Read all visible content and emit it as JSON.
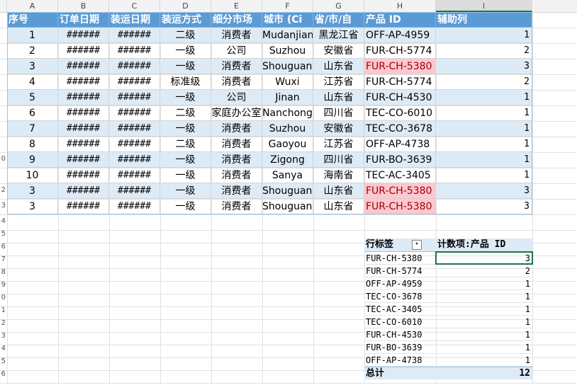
{
  "column_letters": [
    "A",
    "B",
    "C",
    "D",
    "E",
    "F",
    "G",
    "H",
    "I"
  ],
  "selected_column": "I",
  "row_numbers": [
    "",
    "",
    "",
    "",
    "",
    "",
    "",
    "",
    "",
    "0",
    "",
    "2",
    "3",
    "4",
    "5",
    "6",
    "7",
    "8",
    "9",
    "0",
    "1",
    "2",
    "3",
    "4",
    "5",
    "6"
  ],
  "table": {
    "headers": [
      "序号",
      "订单日期",
      "装运日期",
      "装运方式",
      "细分市场",
      "城市 (Ci",
      "省/市/自",
      "产品 ID",
      "辅助列"
    ],
    "rows": [
      {
        "no": "1",
        "order": "######",
        "ship": "######",
        "mode": "二级",
        "seg": "消费者",
        "city": "Mudanjiang",
        "prov": "黑龙江省",
        "pid": "OFF-AP-4959",
        "aux": "1",
        "hl": false
      },
      {
        "no": "2",
        "order": "######",
        "ship": "######",
        "mode": "一级",
        "seg": "公司",
        "city": "Suzhou",
        "prov": "安徽省",
        "pid": "FUR-CH-5774",
        "aux": "2",
        "hl": false
      },
      {
        "no": "3",
        "order": "######",
        "ship": "######",
        "mode": "一级",
        "seg": "消费者",
        "city": "Shouguang",
        "prov": "山东省",
        "pid": "FUR-CH-5380",
        "aux": "3",
        "hl": true
      },
      {
        "no": "4",
        "order": "######",
        "ship": "######",
        "mode": "标准级",
        "seg": "消费者",
        "city": "Wuxi",
        "prov": "江苏省",
        "pid": "FUR-CH-5774",
        "aux": "2",
        "hl": false
      },
      {
        "no": "5",
        "order": "######",
        "ship": "######",
        "mode": "一级",
        "seg": "公司",
        "city": "Jinan",
        "prov": "山东省",
        "pid": "FUR-CH-4530",
        "aux": "1",
        "hl": false
      },
      {
        "no": "6",
        "order": "######",
        "ship": "######",
        "mode": "二级",
        "seg": "家庭办公室",
        "city": "Nanchong",
        "prov": "四川省",
        "pid": "TEC-CO-6010",
        "aux": "1",
        "hl": false
      },
      {
        "no": "7",
        "order": "######",
        "ship": "######",
        "mode": "一级",
        "seg": "消费者",
        "city": "Suzhou",
        "prov": "安徽省",
        "pid": "TEC-CO-3678",
        "aux": "1",
        "hl": false
      },
      {
        "no": "8",
        "order": "######",
        "ship": "######",
        "mode": "二级",
        "seg": "消费者",
        "city": "Gaoyou",
        "prov": "江苏省",
        "pid": "OFF-AP-4738",
        "aux": "1",
        "hl": false
      },
      {
        "no": "9",
        "order": "######",
        "ship": "######",
        "mode": "一级",
        "seg": "消费者",
        "city": "Zigong",
        "prov": "四川省",
        "pid": "FUR-BO-3639",
        "aux": "1",
        "hl": false
      },
      {
        "no": "10",
        "order": "######",
        "ship": "######",
        "mode": "一级",
        "seg": "消费者",
        "city": "Sanya",
        "prov": "海南省",
        "pid": "TEC-AC-3405",
        "aux": "1",
        "hl": false
      },
      {
        "no": "3",
        "order": "######",
        "ship": "######",
        "mode": "一级",
        "seg": "消费者",
        "city": "Shouguang",
        "prov": "山东省",
        "pid": "FUR-CH-5380",
        "aux": "3",
        "hl": true
      },
      {
        "no": "3",
        "order": "######",
        "ship": "######",
        "mode": "一级",
        "seg": "消费者",
        "city": "Shouguang",
        "prov": "山东省",
        "pid": "FUR-CH-5380",
        "aux": "3",
        "hl": true
      }
    ]
  },
  "pivot": {
    "row_label": "行标签",
    "value_label": "计数项:产品 ID",
    "filter_icon": "filter-dropdown-icon",
    "rows": [
      {
        "label": "FUR-CH-5380",
        "count": "3"
      },
      {
        "label": "FUR-CH-5774",
        "count": "2"
      },
      {
        "label": "OFF-AP-4959",
        "count": "1"
      },
      {
        "label": "TEC-CO-3678",
        "count": "1"
      },
      {
        "label": "TEC-AC-3405",
        "count": "1"
      },
      {
        "label": "TEC-CO-6010",
        "count": "1"
      },
      {
        "label": "FUR-CH-4530",
        "count": "1"
      },
      {
        "label": "FUR-BO-3639",
        "count": "1"
      },
      {
        "label": "OFF-AP-4738",
        "count": "1"
      }
    ],
    "total_label": "总计",
    "total_value": "12"
  },
  "colors": {
    "header_blue": "#5b9bd5",
    "band_blue": "#ddebf7",
    "highlight_bg": "#ffc7ce",
    "highlight_text": "#9c0006",
    "excel_green": "#217346"
  }
}
